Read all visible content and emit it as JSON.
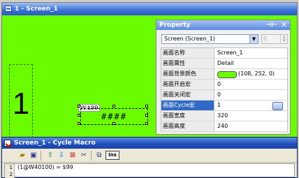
{
  "screen": {
    "title": "1 - Screen_1",
    "big_number": "1",
    "address_label": "W:$99",
    "numeric_display": "####",
    "background": "#6cfc00"
  },
  "property": {
    "title": "Property",
    "selector": "Screen (Screen_1)",
    "spin_value": "0",
    "rows": [
      {
        "name": "画面名称",
        "value": "Screen_1"
      },
      {
        "name": "画面属性",
        "value": "Detail"
      },
      {
        "name": "画面背景颜色",
        "value": "(108, 252, 0)"
      },
      {
        "name": "画面开启宏",
        "value": "0"
      },
      {
        "name": "画面关闭宏",
        "value": "0"
      },
      {
        "name": "画面Cycle宏",
        "value": "1"
      },
      {
        "name": "画面宽度",
        "value": "320"
      },
      {
        "name": "画面高度",
        "value": "240"
      }
    ]
  },
  "macro": {
    "title": "Screen_1 - Cycle Macro",
    "ins_label": "Ins",
    "lines": [
      {
        "num": "1",
        "text": "(1@W40100) = $99"
      },
      {
        "num": "2",
        "text": ""
      }
    ]
  }
}
